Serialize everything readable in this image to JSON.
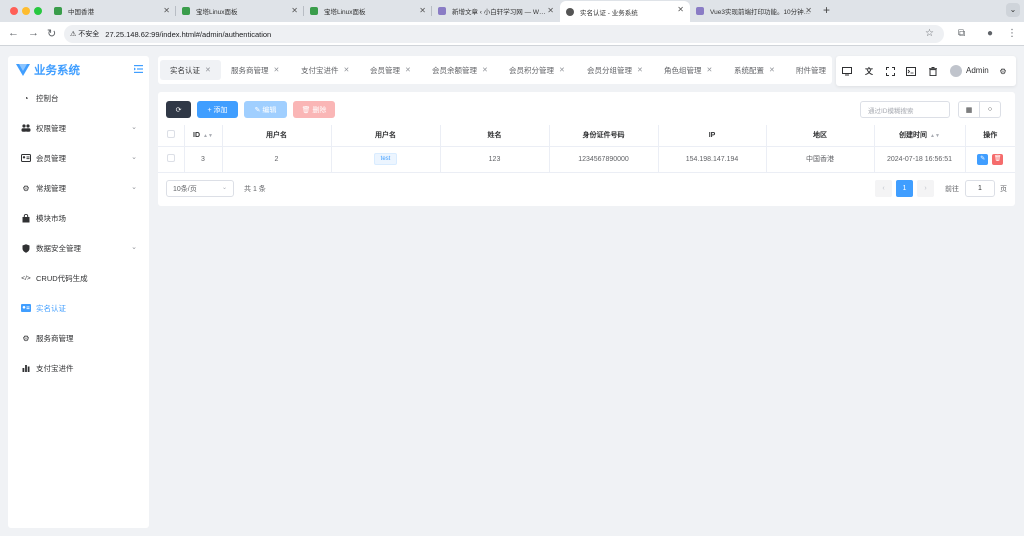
{
  "browser": {
    "tabs": [
      {
        "label": "中国香港",
        "fav_color": "#3a9d4b"
      },
      {
        "label": "宝塔Linux面板",
        "fav_color": "#3a9d4b"
      },
      {
        "label": "宝塔Linux面板",
        "fav_color": "#3a9d4b"
      },
      {
        "label": "新增文章 ‹ 小白轩学习网 — W…",
        "fav_color": "#8a7cc5"
      },
      {
        "label": "实名认证 - 业务系统",
        "fav_color": "#555555"
      },
      {
        "label": "Vue3实现前端打印功能。10分钟…",
        "fav_color": "#8a7cc5"
      }
    ],
    "security_label": "不安全",
    "url": "27.25.148.62:99/index.html#/admin/authentication"
  },
  "sidebar": {
    "title": "业务系统",
    "items": [
      {
        "label": "控制台",
        "icon": "dashboard-icon",
        "glyph": "◔",
        "caret": false
      },
      {
        "label": "权限管理",
        "icon": "users-icon",
        "glyph": "👥",
        "caret": true
      },
      {
        "label": "会员管理",
        "icon": "id-card-icon",
        "glyph": "▣",
        "caret": true
      },
      {
        "label": "常规管理",
        "icon": "gears-icon",
        "glyph": "⚙",
        "caret": true
      },
      {
        "label": "模块市场",
        "icon": "shopping-bag-icon",
        "glyph": "▲",
        "caret": false
      },
      {
        "label": "数据安全管理",
        "icon": "shield-icon",
        "glyph": "⛨",
        "caret": true
      },
      {
        "label": "CRUD代码生成",
        "icon": "code-icon",
        "glyph": "</>",
        "caret": false
      },
      {
        "label": "实名认证",
        "icon": "id-card-icon",
        "glyph": "▣",
        "caret": false
      },
      {
        "label": "服务商管理",
        "icon": "gear-icon",
        "glyph": "⚙",
        "caret": false
      },
      {
        "label": "支付宝进件",
        "icon": "bar-chart-icon",
        "glyph": "▮",
        "caret": false
      }
    ],
    "active_index": 7
  },
  "tags": [
    {
      "label": "实名认证",
      "active": true
    },
    {
      "label": "服务商管理",
      "active": false
    },
    {
      "label": "支付宝进件",
      "active": false
    },
    {
      "label": "会员管理",
      "active": false
    },
    {
      "label": "会员余额管理",
      "active": false
    },
    {
      "label": "会员积分管理",
      "active": false
    },
    {
      "label": "会员分组管理",
      "active": false
    },
    {
      "label": "角色组管理",
      "active": false
    },
    {
      "label": "系统配置",
      "active": false
    },
    {
      "label": "附件管理",
      "active": false
    }
  ],
  "header": {
    "admin_name": "Admin"
  },
  "toolbar": {
    "refresh_glyph": "⟳",
    "add_label": "+ 添加",
    "edit_label": "✎ 编辑",
    "delete_label": "🗑 删除",
    "search_placeholder": "通过ID模糊搜索"
  },
  "table": {
    "columns": [
      "",
      "ID",
      "用户名",
      "用户名",
      "姓名",
      "身份证件号码",
      "IP",
      "地区",
      "创建时间",
      "操作"
    ],
    "rows": [
      {
        "id": "3",
        "user_id": "2",
        "username": "test",
        "name": "123",
        "id_number": "1234567890000",
        "ip": "154.198.147.194",
        "region": "中国香港",
        "created": "2024-07-18 16:56:51"
      }
    ]
  },
  "pager": {
    "page_size": "10条/页",
    "total": "共 1 条",
    "current": "1",
    "goto_label": "前往",
    "goto_value": "1",
    "goto_unit": "页"
  },
  "colors": {
    "primary": "#409eff",
    "dark": "#303846",
    "danger": "#f56c6c"
  }
}
